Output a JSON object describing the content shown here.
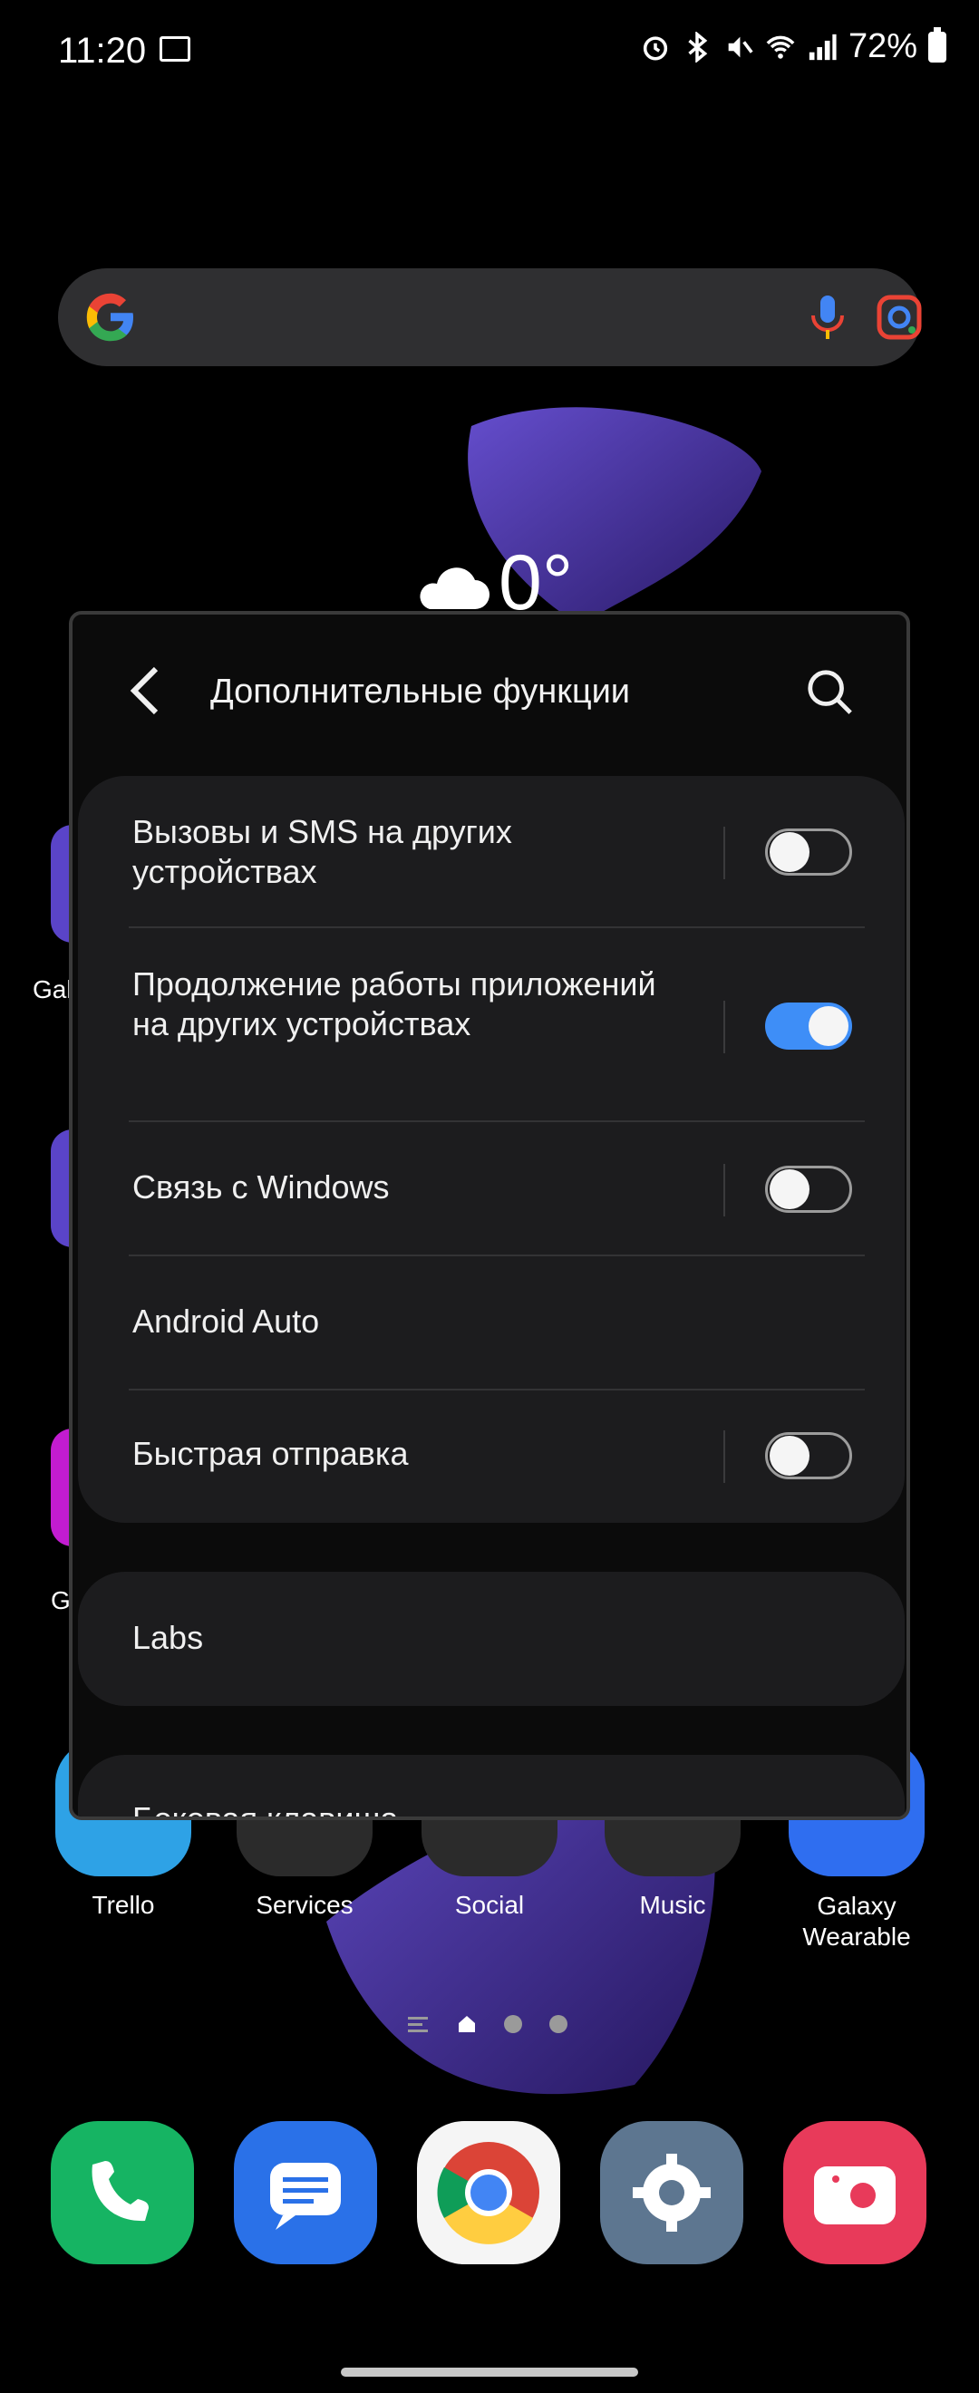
{
  "status_bar": {
    "time": "11:20",
    "battery": "72%"
  },
  "home": {
    "apps_row": [
      {
        "label": "Trello",
        "color": "#2ea2e6"
      },
      {
        "label": "Services",
        "color": "#2b2b2b"
      },
      {
        "label": "Social",
        "color": "#2b2b2b"
      },
      {
        "label": "Music",
        "color": "#2b2b2b"
      },
      {
        "label": "Galaxy Wearable",
        "color": "#2f6ef0"
      }
    ],
    "partial_labels": [
      "Gal",
      "G"
    ],
    "weather_temp": "0°",
    "dock": [
      "phone",
      "messages",
      "chrome",
      "settings",
      "camera"
    ]
  },
  "popup": {
    "title": "Дополнительные функции",
    "items": [
      {
        "label": "Вызовы и SMS на других устройствах",
        "toggle": false
      },
      {
        "label": "Продолжение работы приложений на других устройствах",
        "toggle": true
      },
      {
        "label": "Связь с Windows",
        "toggle": false
      },
      {
        "label": "Android Auto"
      },
      {
        "label": "Быстрая отправка",
        "toggle": false
      }
    ],
    "labs": "Labs",
    "next_section": "Боковая клавиша"
  },
  "colors": {
    "accent": "#3e8ef7",
    "card": "#1c1c1e"
  }
}
